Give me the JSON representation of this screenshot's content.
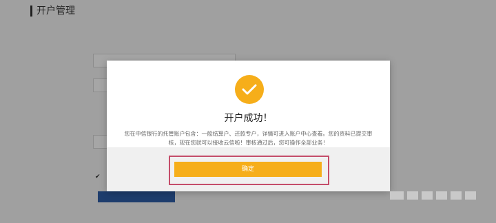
{
  "page": {
    "title": "开户管理"
  },
  "modal": {
    "title": "开户成功！",
    "message": "您在中信银行的托管账户包含：一般结算户、还款专户，详情可进入账户中心查看。您的资料已提交审核，现在您就可以接收云信啦！审核通过后，您可操作全部业务！",
    "confirm_label": "确定"
  },
  "colors": {
    "accent": "#f6ae1a",
    "highlight": "#c44d6a"
  }
}
